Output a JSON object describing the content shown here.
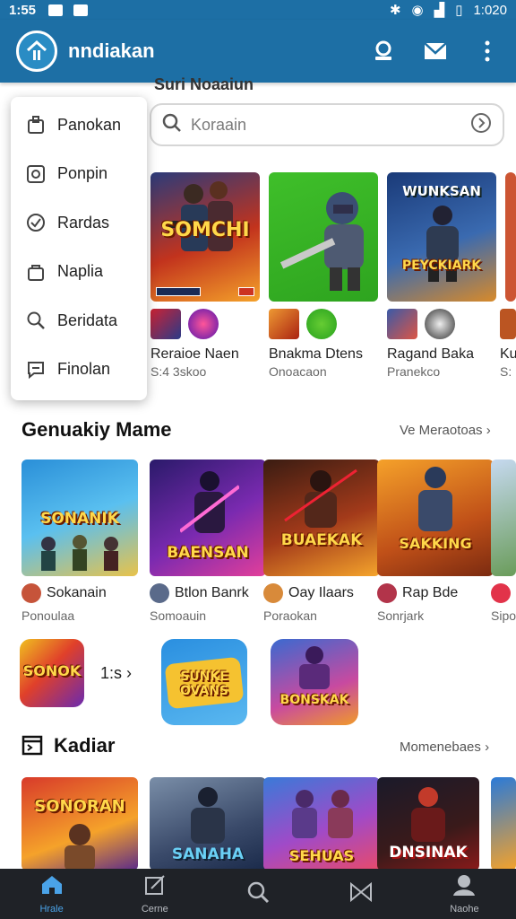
{
  "status_bar": {
    "time": "1:55",
    "right_time": "1:020"
  },
  "app_bar": {
    "title": "nndiakan"
  },
  "hidden_heading": "Suri Noaaiun",
  "search": {
    "placeholder": "Koraain"
  },
  "menu": {
    "items": [
      {
        "label": "Panokan",
        "icon": "box-icon"
      },
      {
        "label": "Ponpin",
        "icon": "image-icon"
      },
      {
        "label": "Rardas",
        "icon": "check-circle-icon"
      },
      {
        "label": "Naplia",
        "icon": "bag-icon"
      },
      {
        "label": "Beridata",
        "icon": "search-icon"
      },
      {
        "label": "Finolan",
        "icon": "message-icon"
      }
    ]
  },
  "featured": [
    {
      "art_text": "SOMCHI",
      "title": "Reraioe Naen",
      "subtitle": "S:4 3skoo"
    },
    {
      "art_text": "",
      "title": "Bnakma Dtens",
      "subtitle": "Onoacaon"
    },
    {
      "art_text": "WUNKSAN",
      "art_text2": "PEYCKIARK",
      "title": "Ragand Baka",
      "subtitle": "Pranekco"
    },
    {
      "art_text": "",
      "title": "Ku",
      "subtitle": "S:"
    }
  ],
  "section1": {
    "title": "Genuakiy Mame",
    "link": "Ve Meraotoas",
    "games": [
      {
        "art_text": "SONANIK",
        "title": "Sokanain",
        "subtitle": "Ponoulaa"
      },
      {
        "art_text": "BAENSAN",
        "title": "Btlon Banrk",
        "subtitle": "Somoauin"
      },
      {
        "art_text": "BUAEKAK",
        "title": "Oay Ilaars",
        "subtitle": "Poraokan"
      },
      {
        "art_text": "SAKKING",
        "title": "Rap Bde",
        "subtitle": "Sonrjark"
      },
      {
        "art_text": "",
        "title": "",
        "subtitle": "Sipo"
      }
    ],
    "tiles": [
      {
        "art_text": "SONOK",
        "label": "1:s"
      },
      {
        "art_text": "SUNKE OVANS",
        "label": ""
      },
      {
        "art_text": "BONSKAK",
        "label": ""
      }
    ]
  },
  "section2": {
    "title": "Kadiar",
    "link": "Momenebaes",
    "games": [
      {
        "art_text": "SONORAN"
      },
      {
        "art_text": "SANAHA"
      },
      {
        "art_text": "SEHUAS"
      },
      {
        "art_text": "DNSINAK"
      },
      {
        "art_text": ""
      }
    ]
  },
  "bottom_nav": [
    {
      "label": "Hrale",
      "icon": "home-icon"
    },
    {
      "label": "Cerne",
      "icon": "edit-icon"
    },
    {
      "label": "",
      "icon": "search-icon"
    },
    {
      "label": "",
      "icon": "bowtie-icon"
    },
    {
      "label": "Naohe",
      "icon": "profile-icon"
    }
  ],
  "colors": {
    "primary": "#1d6fa5",
    "nav_bg": "#1f2227",
    "nav_active": "#4aa3e8"
  }
}
